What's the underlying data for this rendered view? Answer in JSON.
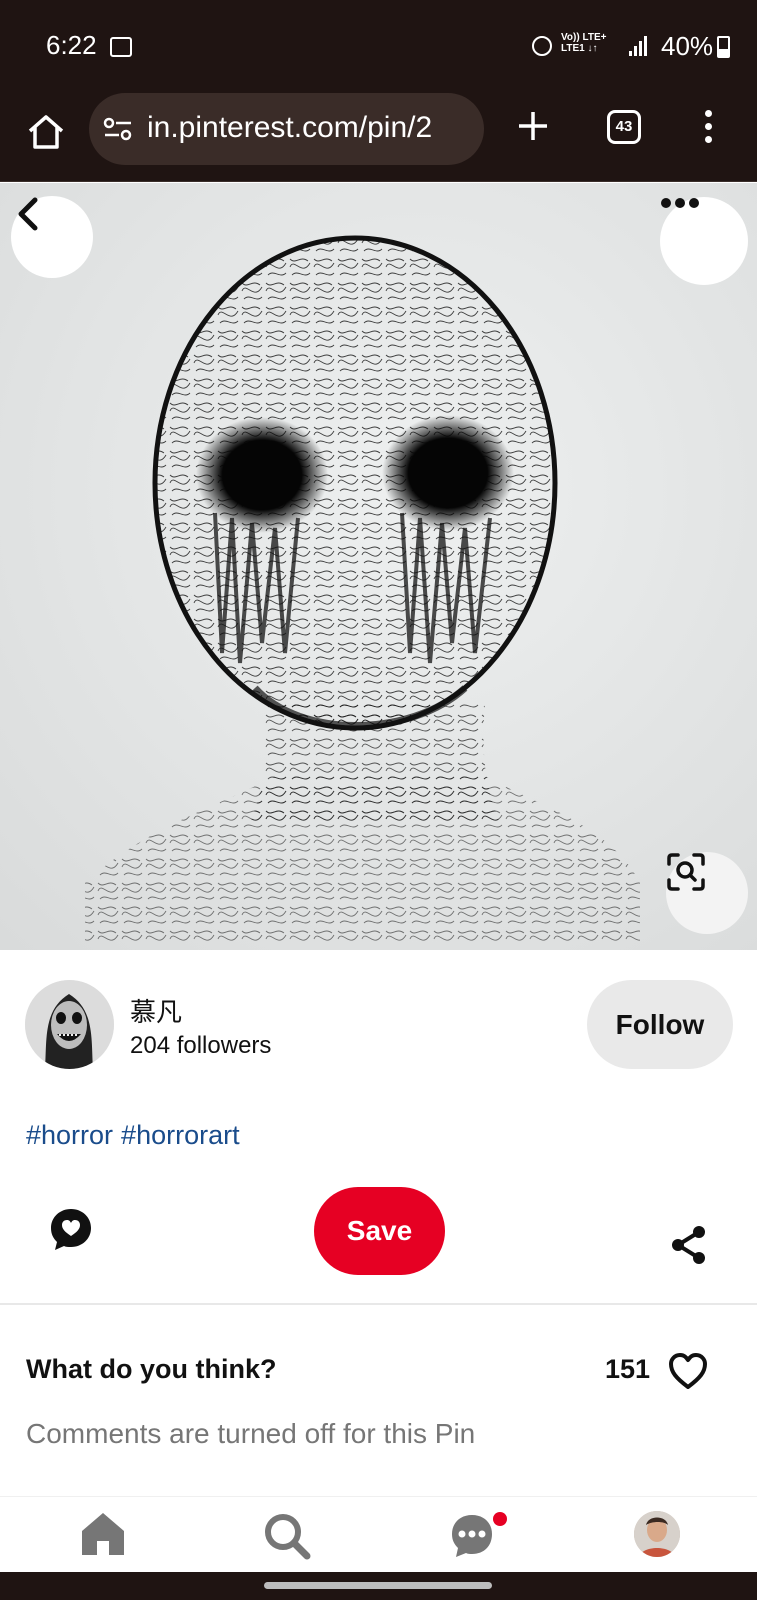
{
  "status_bar": {
    "time": "6:22",
    "network_top": "Vo)) LTE+",
    "network_bottom": "LTE1 ↓↑",
    "battery": "40%",
    "battery_level": 0.4
  },
  "browser": {
    "url": "in.pinterest.com/pin/2",
    "tab_count": "43"
  },
  "pin": {
    "image_icon_names": [
      "back-icon",
      "more-icon",
      "visual-search-icon"
    ]
  },
  "creator": {
    "name": "慕凡",
    "followers": "204 followers",
    "follow_label": "Follow"
  },
  "tags": [
    "#horror",
    "#horrorart"
  ],
  "actions": {
    "save_label": "Save"
  },
  "comments": {
    "heading": "What do you think?",
    "like_count": "151",
    "closed_text": "Comments are turned off for this Pin"
  },
  "bottom_nav": {
    "items": [
      "home-icon",
      "search-icon",
      "messages-icon",
      "profile-avatar"
    ],
    "notification_color": "#e60023"
  },
  "colors": {
    "brand_red": "#e60023",
    "browser_chrome": "#1f1412",
    "tag_link": "#1a4c8b"
  }
}
